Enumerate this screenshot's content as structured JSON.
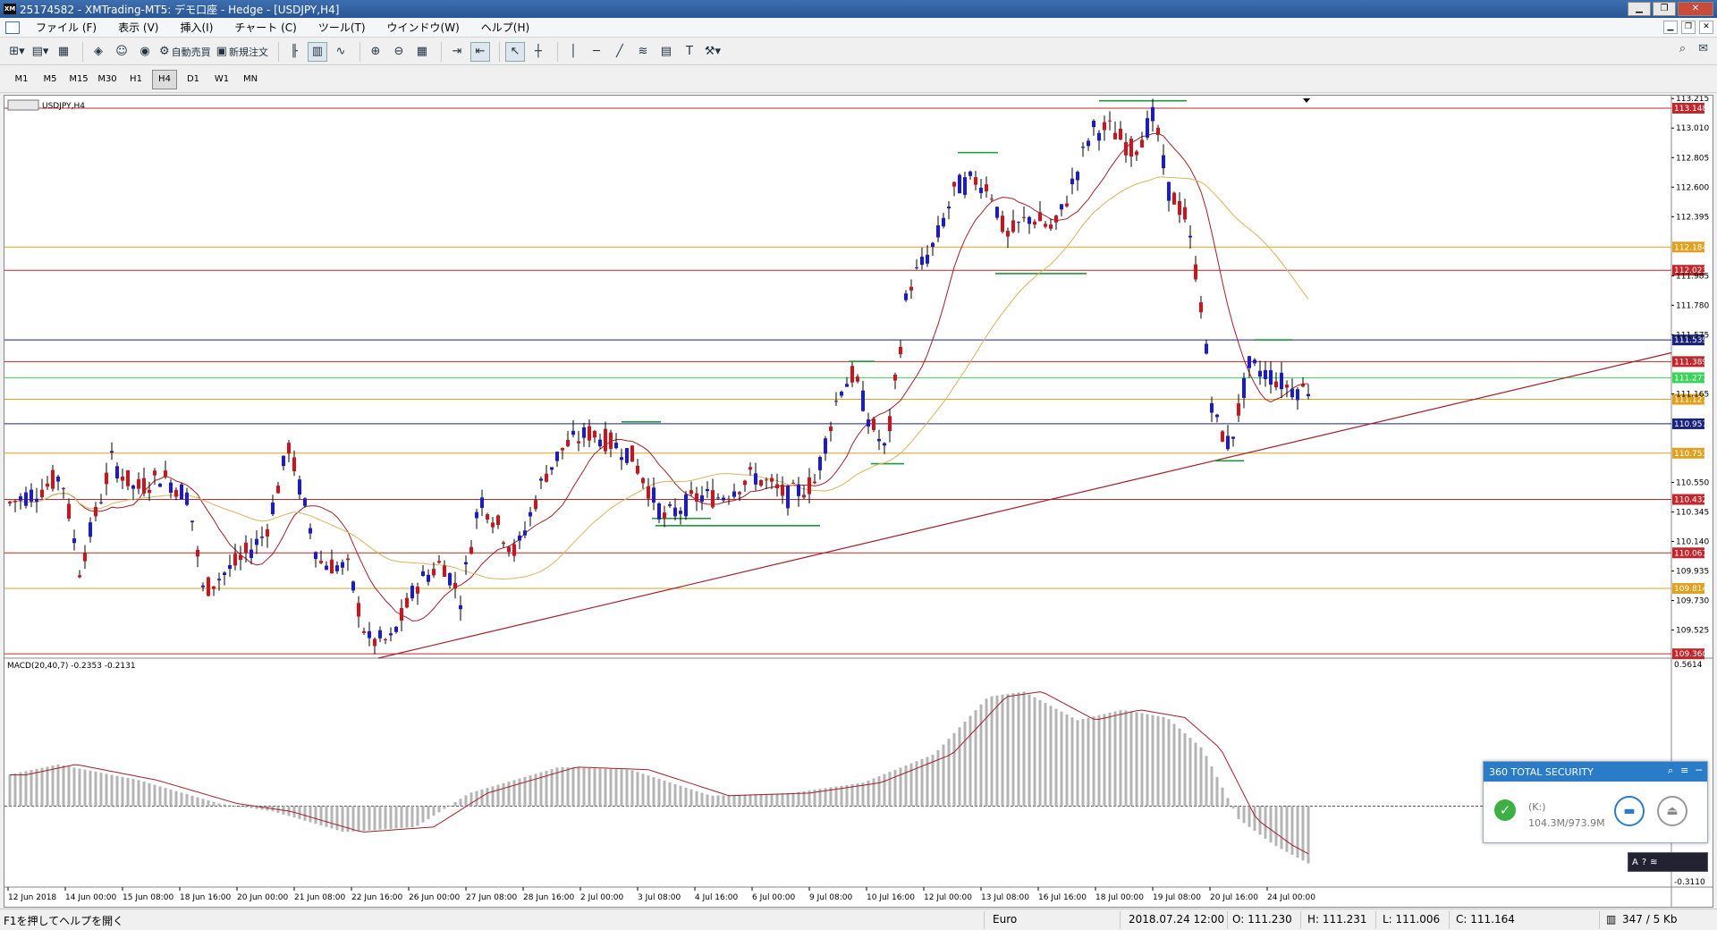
{
  "window": {
    "title": "25174582 - XMTrading-MT5: デモ口座 - Hedge - [USDJPY,H4]",
    "app_icon_text": "XM"
  },
  "menu": [
    "ファイル (F)",
    "表示 (V)",
    "挿入(I)",
    "チャート (C)",
    "ツール(T)",
    "ウインドウ(W)",
    "ヘルプ(H)"
  ],
  "toolbar": {
    "auto_trade_label": "自動売買",
    "new_order_label": "新規注文"
  },
  "timeframes": [
    "M1",
    "M5",
    "M15",
    "M30",
    "H1",
    "H4",
    "D1",
    "W1",
    "MN"
  ],
  "active_timeframe": "H4",
  "chart": {
    "symbol_label": "USDJPY,H4",
    "price_ticks": [
      "113.215",
      "113.010",
      "112.805",
      "112.600",
      "112.395",
      "111.985",
      "111.780",
      "111.575",
      "111.165",
      "110.550",
      "110.345",
      "110.140",
      "109.935",
      "109.730",
      "109.525"
    ],
    "price_tick_values": [
      113.215,
      113.01,
      112.805,
      112.6,
      112.395,
      111.985,
      111.78,
      111.575,
      111.165,
      110.55,
      110.345,
      110.14,
      109.935,
      109.73,
      109.525
    ],
    "price_range": [
      109.33,
      113.235
    ],
    "hlines": [
      {
        "price": 113.148,
        "label": "113.148",
        "color": "#c0282d",
        "box": "#c0282d"
      },
      {
        "price": 112.184,
        "label": "112.184",
        "color": "#e0a020",
        "box": "#e0a020"
      },
      {
        "price": 112.023,
        "label": "112.023",
        "color": "#c0282d",
        "box": "#c0282d"
      },
      {
        "price": 111.539,
        "label": "111.539",
        "color": "#1a237e",
        "box": "#1a237e"
      },
      {
        "price": 111.389,
        "label": "111.389",
        "color": "#c0282d",
        "box": "#c0282d"
      },
      {
        "price": 111.277,
        "label": "111.277",
        "color": "#3cd55a",
        "box": "#3cd55a"
      },
      {
        "price": 111.127,
        "label": "111.127",
        "color": "#e0a020",
        "box": "#e0a020"
      },
      {
        "price": 110.957,
        "label": "110.957",
        "color": "#1a237e",
        "box": "#1a237e"
      },
      {
        "price": 110.753,
        "label": "110.753",
        "color": "#e0a020",
        "box": "#e0a020"
      },
      {
        "price": 110.432,
        "label": "110.432",
        "color": "#c0282d",
        "box": "#c0282d"
      },
      {
        "price": 110.061,
        "label": "110.061",
        "color": "#c0282d",
        "box": "#c0282d"
      },
      {
        "price": 109.814,
        "label": "109.814",
        "color": "#e0a020",
        "box": "#e0a020"
      },
      {
        "price": 109.36,
        "label": "109.360",
        "color": "#c0282d",
        "box": "#c0282d"
      }
    ],
    "time_labels": [
      "12 Jun 2018",
      "14 Jun 00:00",
      "15 Jun 08:00",
      "18 Jun 16:00",
      "20 Jun 00:00",
      "21 Jun 08:00",
      "22 Jun 16:00",
      "26 Jun 00:00",
      "27 Jun 08:00",
      "28 Jun 16:00",
      "2 Jul 00:00",
      "3 Jul 08:00",
      "4 Jul 16:00",
      "6 Jul 00:00",
      "9 Jul 08:00",
      "10 Jul 16:00",
      "12 Jul 00:00",
      "13 Jul 08:00",
      "16 Jul 16:00",
      "18 Jul 00:00",
      "19 Jul 08:00",
      "20 Jul 16:00",
      "24 Jul 00:00"
    ],
    "colors": {
      "bull": "#d0131b",
      "bear": "#1a1ad0",
      "ma_fast": "#a0202a",
      "ma_slow": "#d9b45a",
      "trend": "#a0202a",
      "levels": "#1a9a3a",
      "macd_hist": "#b4b4b4",
      "macd_signal": "#a0202a"
    }
  },
  "macd": {
    "label": "MACD(20,40,7) -0.2353 -0.2131",
    "top": "0.5614",
    "bottom": "-0.3110"
  },
  "status": {
    "help": "F1を押してヘルプを開く",
    "profile": "Euro",
    "datetime": "2018.07.24 12:00",
    "open": "O: 111.230",
    "high": "H: 111.231",
    "low": "L: 111.006",
    "close": "C: 111.164",
    "traffic": "347 / 5 Kb"
  },
  "security_popup": {
    "title": "360 TOTAL SECURITY",
    "drive": "(K:)",
    "usage": "104.3M/973.9M"
  }
}
